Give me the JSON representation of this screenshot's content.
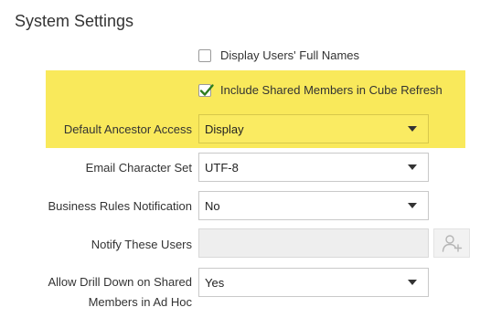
{
  "page": {
    "title": "System Settings"
  },
  "settings": {
    "display_full_names": {
      "label": "Display Users' Full Names",
      "checked": false
    },
    "include_shared_members": {
      "label": "Include Shared Members in Cube Refresh",
      "checked": true
    },
    "default_ancestor_access": {
      "label": "Default Ancestor Access",
      "value": "Display"
    },
    "email_character_set": {
      "label": "Email Character Set",
      "value": "UTF-8"
    },
    "business_rules_notification": {
      "label": "Business Rules Notification",
      "value": "No"
    },
    "notify_these_users": {
      "label": "Notify These Users",
      "value": ""
    },
    "allow_drill_down": {
      "label_line1": "Allow Drill Down on Shared",
      "label_line2": "Members in Ad Hoc",
      "value": "Yes"
    }
  },
  "colors": {
    "highlight": "#f9e95b",
    "check": "#2e7d1f"
  },
  "icons": {
    "add_user": "add-user-icon",
    "check": "check-icon",
    "dropdown": "chevron-down-icon"
  }
}
